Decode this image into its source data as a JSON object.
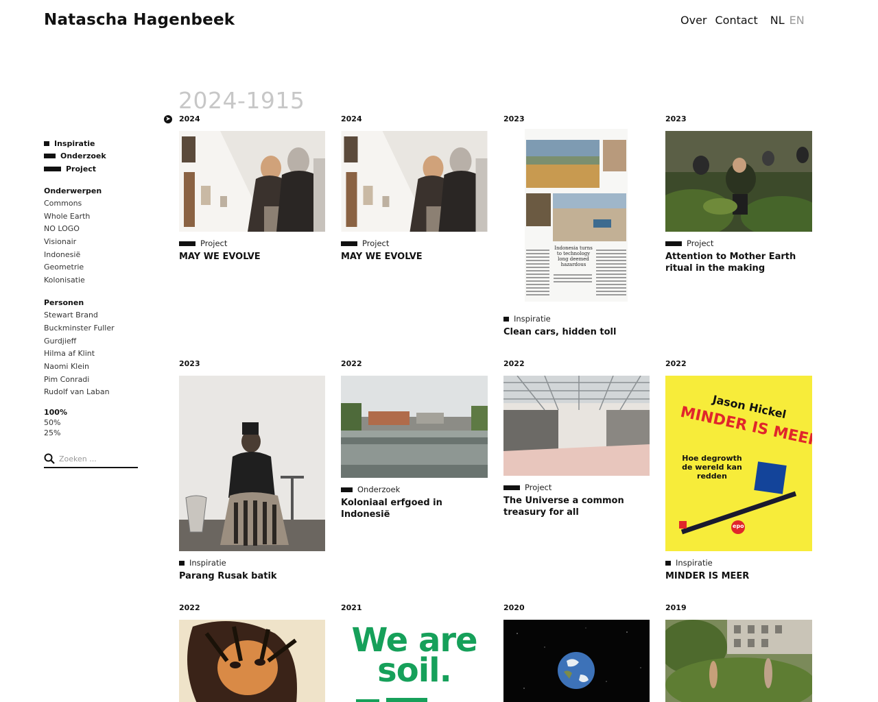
{
  "site": {
    "title": "Natascha Hagenbeek"
  },
  "nav": {
    "about": "Over",
    "contact": "Contact",
    "lang_nl": "NL",
    "lang_en": "EN"
  },
  "period": "2024-1915",
  "sidebar": {
    "types": [
      {
        "label": "Inspiratie"
      },
      {
        "label": "Onderzoek"
      },
      {
        "label": "Project"
      }
    ],
    "subjects_title": "Onderwerpen",
    "subjects": [
      "Commons",
      "Whole Earth",
      "NO LOGO",
      "Visionair",
      "Indonesië",
      "Geometrie",
      "Kolonisatie"
    ],
    "people_title": "Personen",
    "people": [
      "Stewart Brand",
      "Buckminster Fuller",
      "Gurdjieff",
      "Hilma af Klint",
      "Naomi Klein",
      "Pim Conradi",
      "Rudolf van Laban"
    ],
    "zoom": [
      "100%",
      "50%",
      "25%"
    ],
    "search_placeholder": "Zoeken ..."
  },
  "items": [
    {
      "year": "2024",
      "type": "Project",
      "title": "MAY WE EVOLVE"
    },
    {
      "year": "2024",
      "type": "Project",
      "title": "MAY WE EVOLVE"
    },
    {
      "year": "2023",
      "type": "Inspiratie",
      "title": "Clean cars, hidden toll",
      "image_text": "Indonesia turns to technology long deemed hazardous"
    },
    {
      "year": "2023",
      "type": "Project",
      "title": "Attention to Mother Earth ritual in the making"
    },
    {
      "year": "2023",
      "type": "Inspiratie",
      "title": "Parang Rusak batik"
    },
    {
      "year": "2022",
      "type": "Onderzoek",
      "title": "Koloniaal erfgoed in Indonesië"
    },
    {
      "year": "2022",
      "type": "Project",
      "title": "The Universe a common treasury for all"
    },
    {
      "year": "2022",
      "type": "Inspiratie",
      "title": "MINDER IS MEER",
      "cover": {
        "author": "Jason Hickel",
        "title": "MINDER IS MEER",
        "subtitle": "Hoe degrowth de wereld kan redden",
        "publisher": "epo"
      }
    },
    {
      "year": "2022"
    },
    {
      "year": "2021",
      "image_text": "We are soil."
    },
    {
      "year": "2020"
    },
    {
      "year": "2019"
    }
  ]
}
